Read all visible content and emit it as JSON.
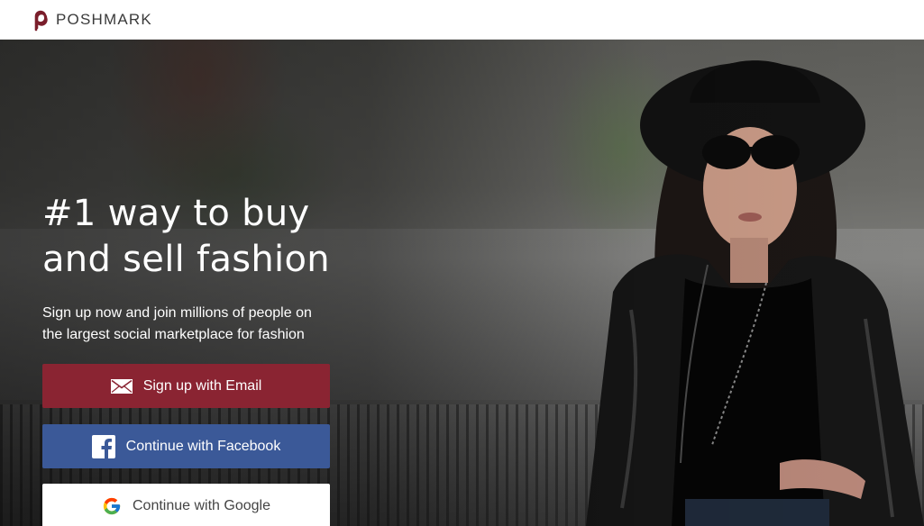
{
  "header": {
    "brand": "POSHMARK",
    "logo_icon": "poshmark-logo-icon"
  },
  "hero": {
    "headline_line1": "#1 way to buy",
    "headline_line2": "and sell fashion",
    "subtext_line1": "Sign up now and join millions of people on",
    "subtext_line2": "the largest social marketplace for fashion"
  },
  "buttons": {
    "email": {
      "label": "Sign up with Email",
      "icon": "envelope-icon"
    },
    "facebook": {
      "label": "Continue with Facebook",
      "icon": "facebook-icon"
    },
    "google": {
      "label": "Continue with Google",
      "icon": "google-icon"
    }
  },
  "colors": {
    "brand": "#8a2432",
    "facebook": "#3b5998",
    "google_button_bg": "#ffffff"
  }
}
